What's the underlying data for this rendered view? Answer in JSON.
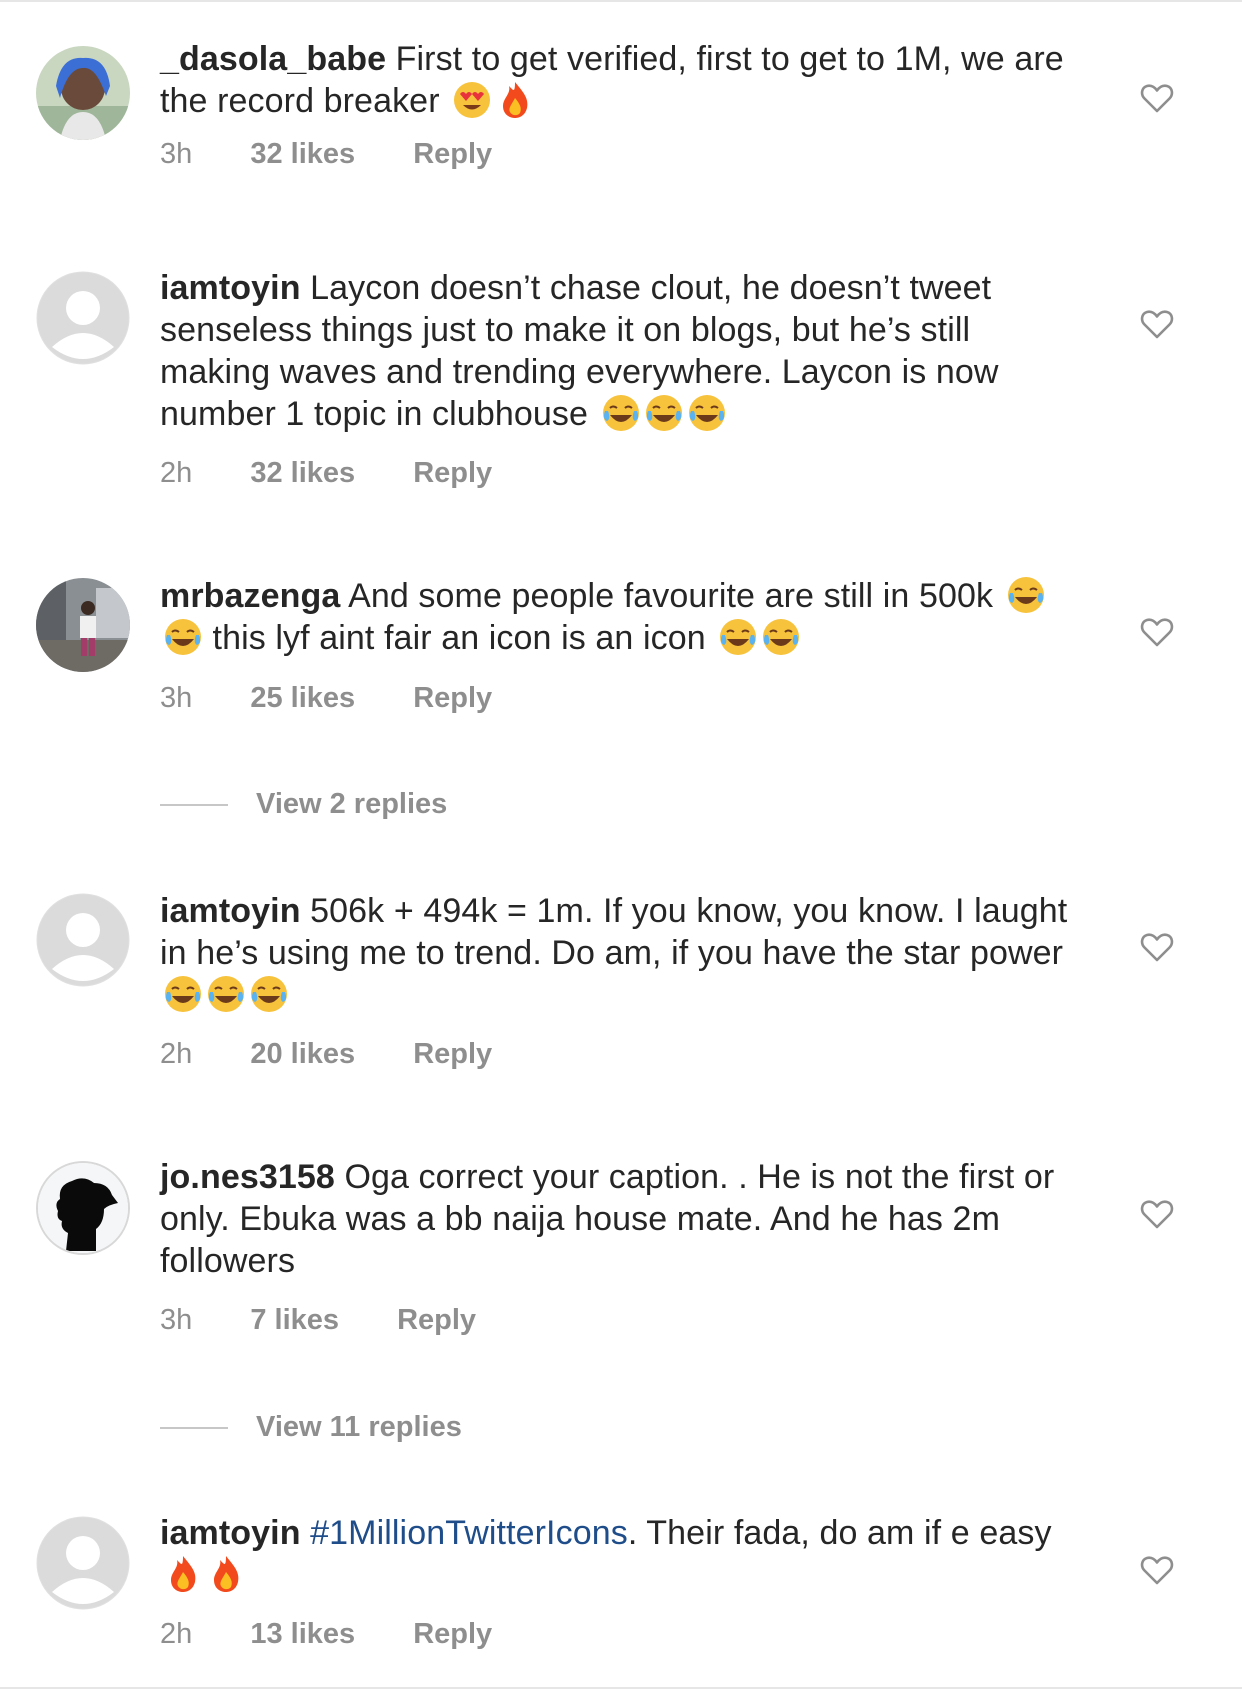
{
  "comments": [
    {
      "username": "_dasola_babe",
      "text": "First to get verified, first to get to 1M, we are the record breaker",
      "emojis": [
        "heart-eyes-emoji",
        "fire-emoji"
      ],
      "time": "3h",
      "likes": "32 likes",
      "reply": "Reply",
      "avatar": "photo-avatar"
    },
    {
      "username": "iamtoyin",
      "text": "Laycon doesn’t chase clout, he doesn’t tweet senseless things just to make it on blogs, but he’s still making waves and trending everywhere. Laycon is now number 1 topic in clubhouse",
      "emojis": [
        "tears-of-joy-emoji",
        "tears-of-joy-emoji",
        "tears-of-joy-emoji"
      ],
      "time": "2h",
      "likes": "32 likes",
      "reply": "Reply",
      "avatar": "default-avatar"
    },
    {
      "username": "mrbazenga",
      "text_a": "And some people favourite are still in 500k",
      "text_b": "this lyf aint fair an icon is an icon",
      "time": "3h",
      "likes": "25 likes",
      "reply": "Reply",
      "avatar": "photo-avatar",
      "view_replies": "View 2 replies"
    },
    {
      "username": "iamtoyin",
      "text": "506k + 494k = 1m. If you know, you know. I laught in he’s using me to trend. Do am, if you have the star power",
      "time": "2h",
      "likes": "20 likes",
      "reply": "Reply",
      "avatar": "default-avatar"
    },
    {
      "username": "jo.nes3158",
      "text": "Oga correct your caption. . He is not the first or only. Ebuka was a bb naija house mate. And he has 2m followers",
      "time": "3h",
      "likes": "7 likes",
      "reply": "Reply",
      "avatar": "silhouette-avatar",
      "view_replies": "View 11 replies"
    },
    {
      "username": "iamtoyin",
      "hashtag": "#1MillionTwitterIcons",
      "text": ". Their fada, do am if e easy",
      "time": "2h",
      "likes": "13 likes",
      "reply": "Reply",
      "avatar": "default-avatar"
    }
  ],
  "colors": {
    "text": "#262626",
    "meta": "#8e8e8e",
    "hashtag": "#1f4d8a",
    "avatar_placeholder": "#dbdbdb"
  }
}
